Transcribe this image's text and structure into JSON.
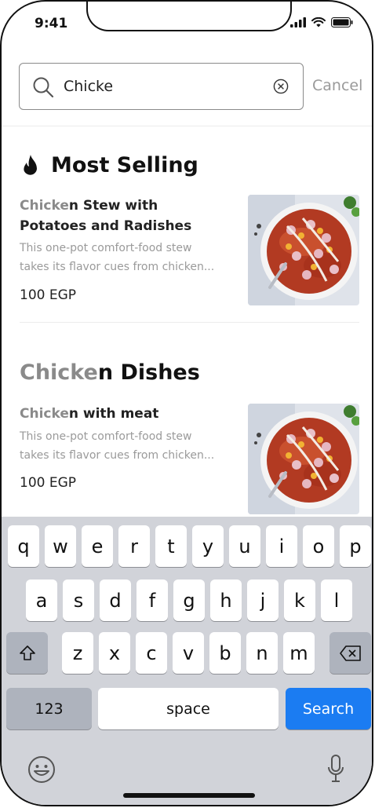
{
  "status_bar": {
    "time": "9:41"
  },
  "search": {
    "query": "Chicke",
    "cancel_label": "Cancel"
  },
  "most_selling": {
    "title": "Most Selling",
    "items": [
      {
        "name_highlight": "Chicke",
        "name_rest_line1": "n Stew with",
        "name_line2": "Potatoes and Radishes",
        "desc_line1": "This one-pot comfort-food stew",
        "desc_line2": "takes its flavor cues from chicken...",
        "price": "100 EGP"
      }
    ]
  },
  "chicken_dishes": {
    "title_highlight": "Chicke",
    "title_rest": "n Dishes",
    "items": [
      {
        "name_highlight": "Chicke",
        "name_rest": "n with meat",
        "desc_line1": "This one-pot comfort-food stew",
        "desc_line2": "takes its flavor cues from chicken...",
        "price": "100 EGP"
      }
    ]
  },
  "keyboard": {
    "row1": [
      "q",
      "w",
      "e",
      "r",
      "t",
      "y",
      "u",
      "i",
      "o",
      "p"
    ],
    "row2": [
      "a",
      "s",
      "d",
      "f",
      "g",
      "h",
      "j",
      "k",
      "l"
    ],
    "row3": [
      "z",
      "x",
      "c",
      "v",
      "b",
      "n",
      "m"
    ],
    "numbers_label": "123",
    "space_label": "space",
    "search_label": "Search"
  },
  "colors": {
    "accent": "#1b7cf2",
    "highlight_text": "#8a8a8a"
  }
}
